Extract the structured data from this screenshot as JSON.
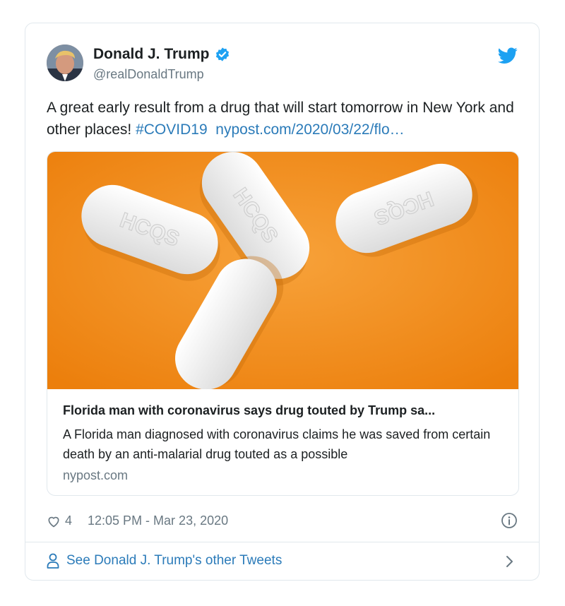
{
  "tweet": {
    "display_name": "Donald J. Trump",
    "handle": "@realDonaldTrump",
    "text_plain": "A great early result from a drug that will start tomorrow in New York and other places! ",
    "hashtag": "#COVID19",
    "url": "nypost.com/2020/03/22/flo…",
    "likes": "4",
    "timestamp": "12:05 PM - Mar 23, 2020"
  },
  "link_card": {
    "image_label": "HCQS",
    "title": "Florida man with coronavirus says drug touted by Trump sa...",
    "description": "A Florida man diagnosed with coronavirus claims he was saved from certain death by an anti-malarial drug touted as a possible",
    "domain": "nypost.com"
  },
  "footer": {
    "more_tweets_label": "See Donald J. Trump's other Tweets"
  },
  "colors": {
    "link": "#2b7bb9",
    "muted": "#697882",
    "border": "#e1e8ed",
    "image_bg": "#f28a12",
    "pill": "#ffffff"
  },
  "icons": [
    "twitter-bird-icon",
    "verified-badge-icon",
    "heart-icon",
    "info-icon",
    "person-icon",
    "chevron-right-icon"
  ]
}
